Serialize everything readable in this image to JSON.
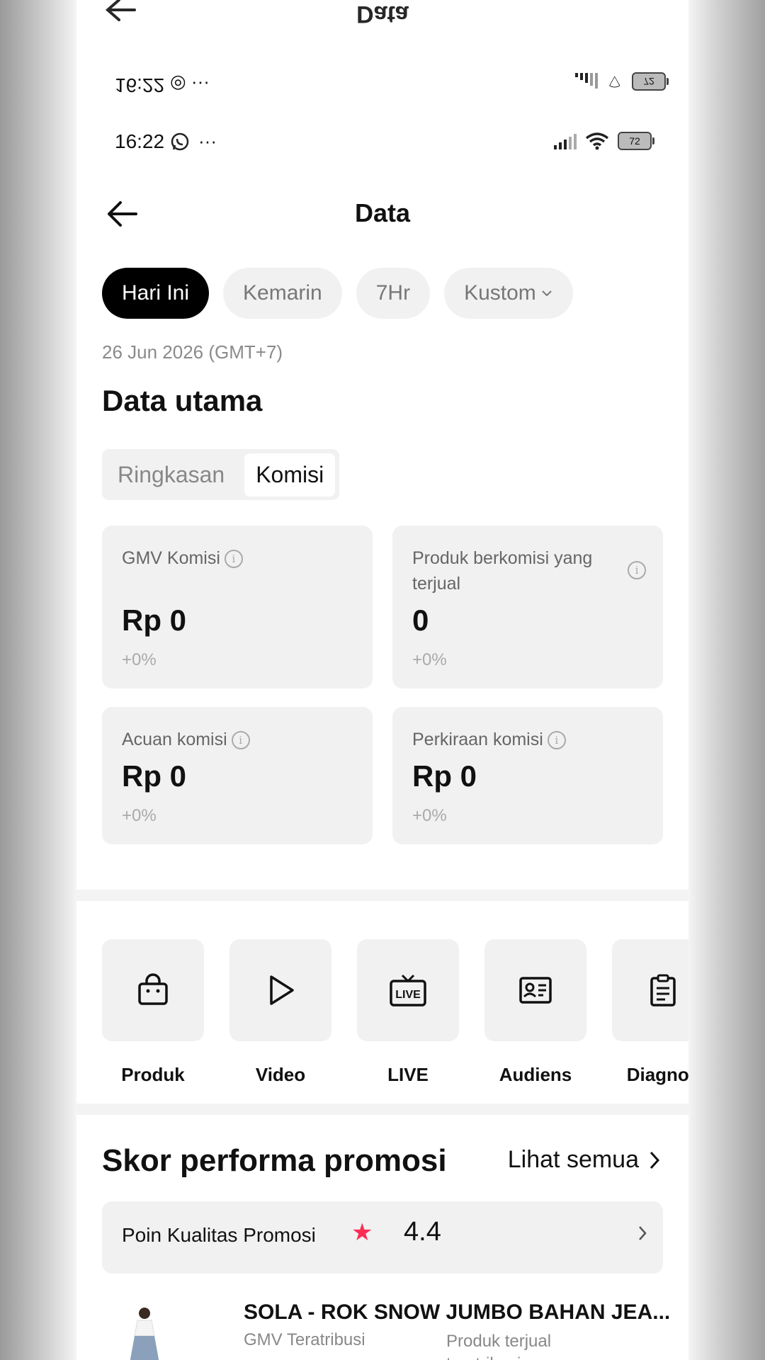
{
  "status": {
    "time": "16:22",
    "battery": "72"
  },
  "header": {
    "title": "Data"
  },
  "filters": [
    {
      "label": "Hari Ini",
      "active": true
    },
    {
      "label": "Kemarin",
      "active": false
    },
    {
      "label": "7Hr",
      "active": false
    },
    {
      "label": "Kustom",
      "active": false
    }
  ],
  "date": "26 Jun 2026 (GMT+7)",
  "main_section": {
    "title": "Data utama",
    "tabs": [
      "Ringkasan",
      "Komisi"
    ],
    "active_tab": "Komisi",
    "cards": [
      {
        "label": "GMV Komisi",
        "value": "Rp 0",
        "delta": "+0%"
      },
      {
        "label": "Produk berkomisi yang terjual",
        "value": "0",
        "delta": "+0%"
      },
      {
        "label": "Acuan komisi",
        "value": "Rp 0",
        "delta": "+0%"
      },
      {
        "label": "Perkiraan komisi",
        "value": "Rp 0",
        "delta": "+0%"
      }
    ]
  },
  "tools": [
    {
      "label": "Produk",
      "icon": "shopping-bag-icon"
    },
    {
      "label": "Video",
      "icon": "play-icon"
    },
    {
      "label": "LIVE",
      "icon": "live-tv-icon"
    },
    {
      "label": "Audiens",
      "icon": "id-card-icon"
    },
    {
      "label": "Diagnos",
      "icon": "clipboard-icon"
    }
  ],
  "promo": {
    "title": "Skor performa promosi",
    "see_all": "Lihat semua",
    "quality_label": "Poin Kualitas Promosi",
    "quality_score": "4.4",
    "star_color": "#fe2c55"
  },
  "product": {
    "name": "SOLA - ROK SNOW JUMBO BAHAN JEA...",
    "meta1": "GMV Teratribusi",
    "meta2": "Produk terjual teratribusi"
  }
}
